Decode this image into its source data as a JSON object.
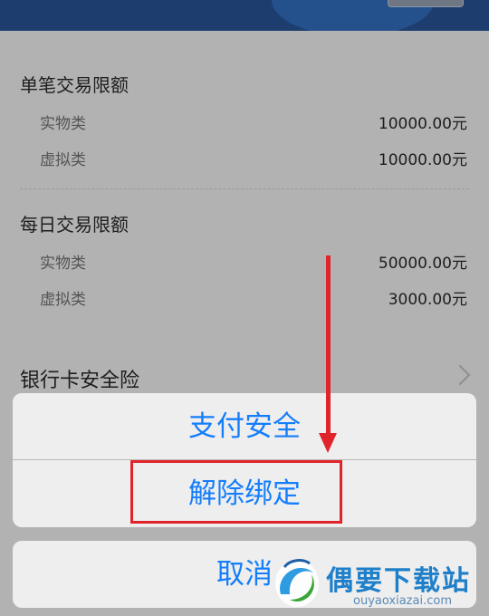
{
  "single_limit": {
    "title": "单笔交易限额",
    "rows": [
      {
        "label": "实物类",
        "value": "10000.00元"
      },
      {
        "label": "虚拟类",
        "value": "10000.00元"
      }
    ]
  },
  "daily_limit": {
    "title": "每日交易限额",
    "rows": [
      {
        "label": "实物类",
        "value": "50000.00元"
      },
      {
        "label": "虚拟类",
        "value": "3000.00元"
      }
    ]
  },
  "insurance": {
    "label": "银行卡安全险",
    "icon": "chevron-right-icon"
  },
  "action_sheet": {
    "options": [
      "支付安全",
      "解除绑定"
    ],
    "cancel": "取消"
  },
  "watermark": {
    "brand": "偶要下载站",
    "url": "ouyaoxiazai.com"
  },
  "colors": {
    "action": "#157efb",
    "annotation": "#e0242b",
    "header": "#1d3d6e"
  }
}
